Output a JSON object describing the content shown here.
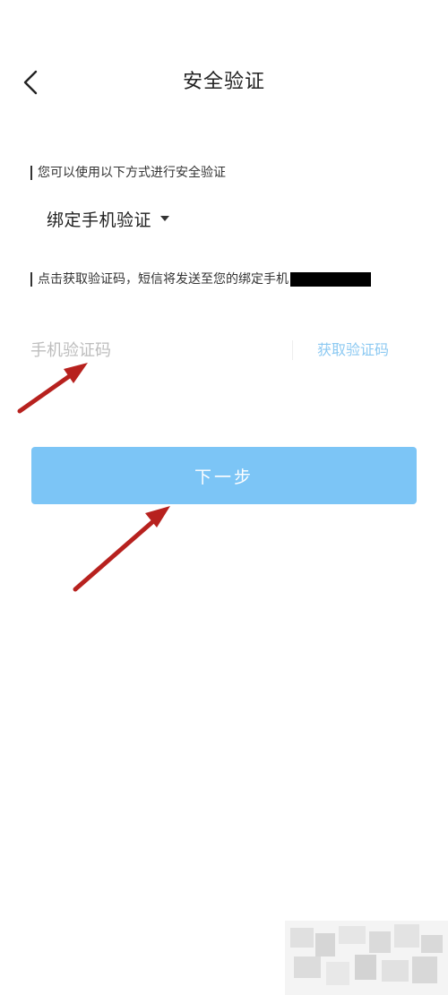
{
  "header": {
    "title": "安全验证",
    "back_icon": "chevron-left-icon"
  },
  "verify_hint": "您可以使用以下方式进行安全验证",
  "method": {
    "selected": "绑定手机验证",
    "caret_icon": "caret-down-icon"
  },
  "sms_hint": "点击获取验证码，短信将发送至您的绑定手机",
  "code_input": {
    "placeholder": "手机验证码",
    "value": ""
  },
  "get_code_label": "获取验证码",
  "next_label": "下一步",
  "colors": {
    "primary_button": "#7cc5f6",
    "link": "#8cc9f2",
    "annotation_arrow": "#b7211e"
  }
}
